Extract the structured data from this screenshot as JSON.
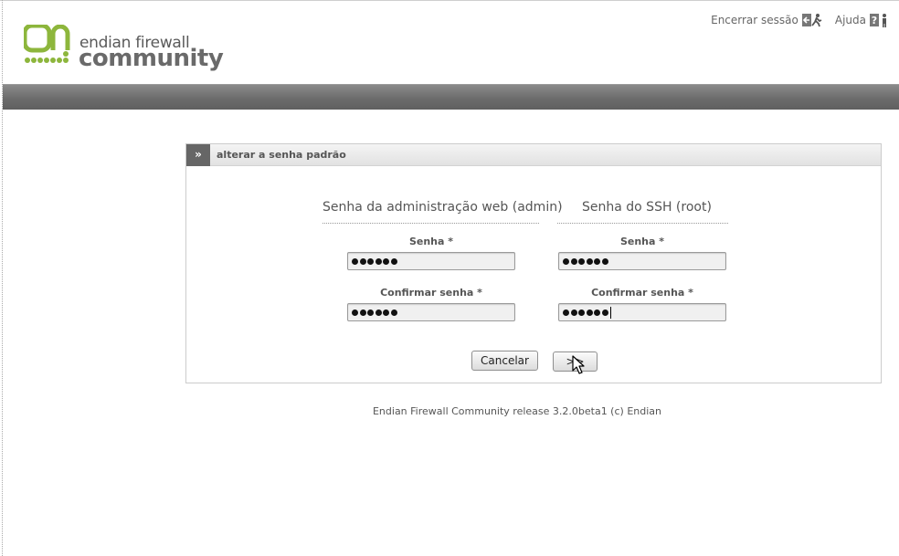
{
  "header": {
    "logo": {
      "line1": "endian firewall",
      "line2": "community",
      "brand_color": "#8db63c"
    },
    "links": [
      {
        "label": "Encerrar sessão",
        "icon": "logout-icon"
      },
      {
        "label": "Ajuda",
        "icon": "help-icon"
      }
    ]
  },
  "panel": {
    "toggle": "»",
    "title": "alterar a senha padrão",
    "columns": [
      {
        "title": "Senha da administração web (admin)",
        "password_label": "Senha *",
        "password_value": "••••••",
        "confirm_label": "Confirmar senha *",
        "confirm_value": "••••••"
      },
      {
        "title": "Senha do SSH (root)",
        "password_label": "Senha *",
        "password_value": "••••••",
        "confirm_label": "Confirmar senha *",
        "confirm_value": "••••••"
      }
    ],
    "buttons": {
      "cancel": "Cancelar",
      "next": ">>"
    }
  },
  "footer": "Endian Firewall Community release 3.2.0beta1 (c) Endian"
}
